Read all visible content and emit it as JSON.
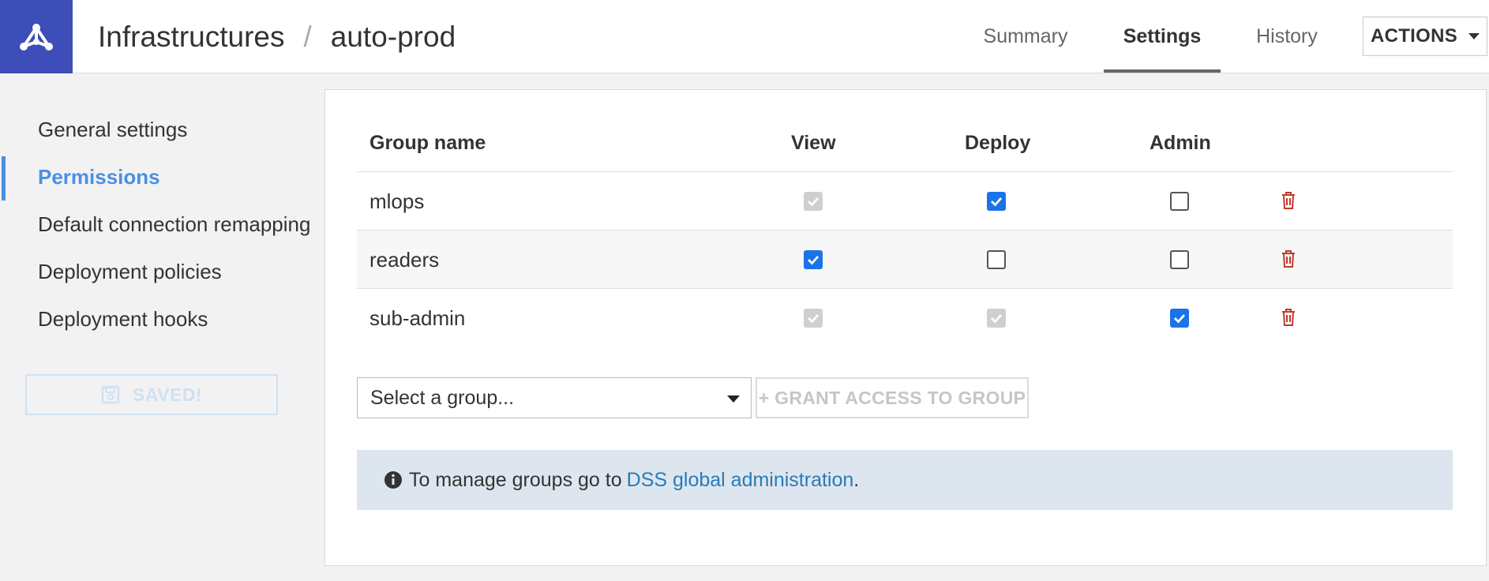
{
  "header": {
    "breadcrumb": [
      "Infrastructures",
      "auto-prod"
    ],
    "tabs": [
      {
        "label": "Summary",
        "active": false
      },
      {
        "label": "Settings",
        "active": true
      },
      {
        "label": "History",
        "active": false
      }
    ],
    "actions_label": "ACTIONS"
  },
  "sidebar": {
    "items": [
      {
        "label": "General settings",
        "active": false
      },
      {
        "label": "Permissions",
        "active": true
      },
      {
        "label": "Default connection remapping",
        "active": false
      },
      {
        "label": "Deployment policies",
        "active": false
      },
      {
        "label": "Deployment hooks",
        "active": false
      }
    ],
    "saved_label": "SAVED!"
  },
  "permissions": {
    "columns": [
      "Group name",
      "View",
      "Deploy",
      "Admin"
    ],
    "rows": [
      {
        "group": "mlops",
        "view": "disabled",
        "deploy": "checked",
        "admin": "unchecked"
      },
      {
        "group": "readers",
        "view": "checked",
        "deploy": "unchecked",
        "admin": "unchecked"
      },
      {
        "group": "sub-admin",
        "view": "disabled",
        "deploy": "disabled",
        "admin": "checked"
      }
    ],
    "select_placeholder": "Select a group...",
    "grant_label": "+ GRANT ACCESS TO GROUP",
    "info_text": "To manage groups go to",
    "info_link": "DSS global administration",
    "info_suffix": "."
  },
  "colors": {
    "brand": "#3d4eb8",
    "accent": "#4a90e2",
    "checkbox": "#1a73e8",
    "delete": "#c0392b",
    "info_bg": "#dde6ee"
  },
  "icons": {
    "logo": "dataiku-bird-icon",
    "save": "floppy-disk-icon",
    "delete": "trash-icon",
    "info": "info-circle-icon"
  }
}
